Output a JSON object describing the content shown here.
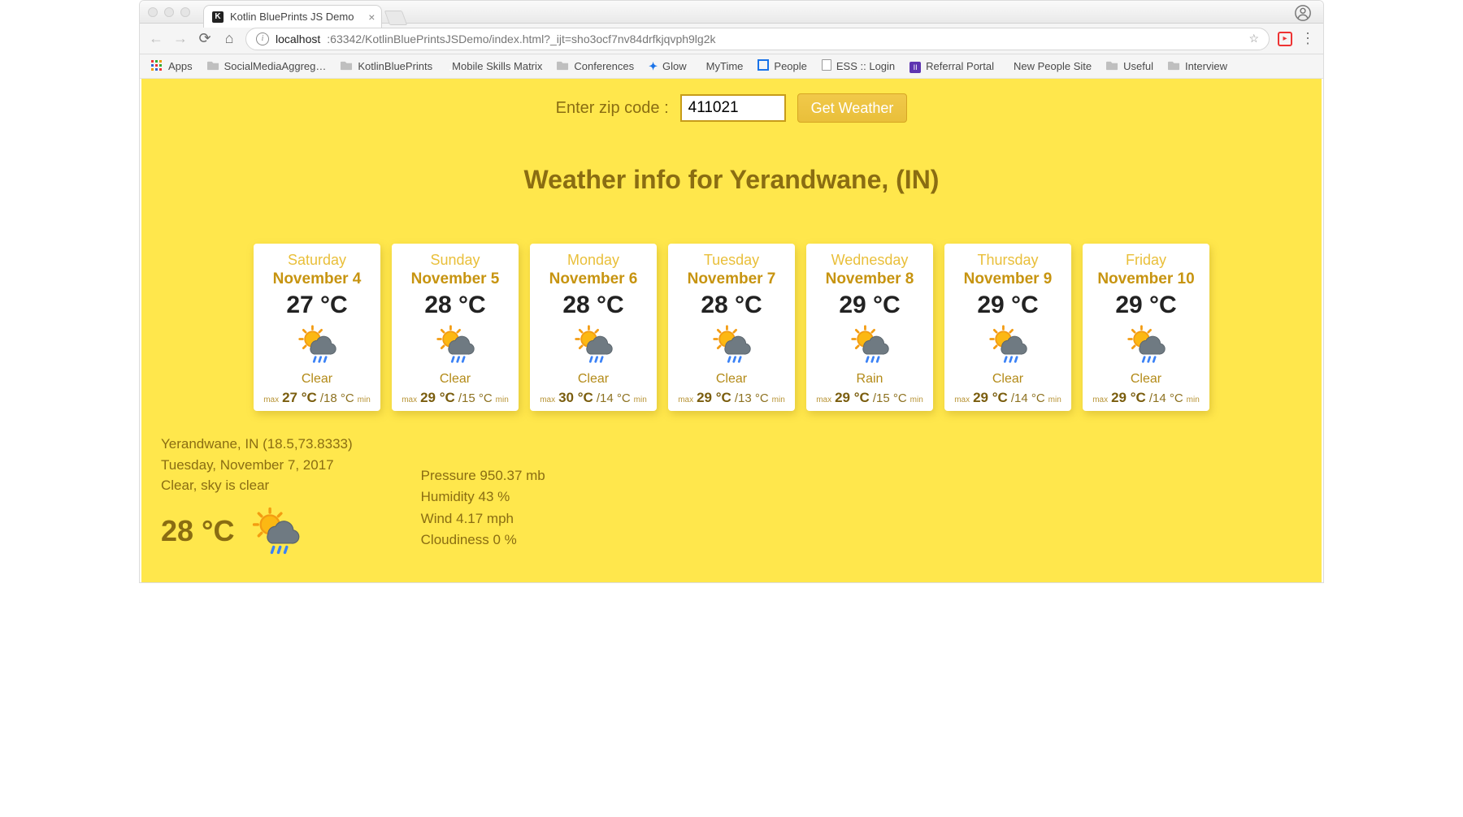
{
  "browser": {
    "tab_title": "Kotlin BluePrints JS Demo",
    "url_host": "localhost",
    "url_path": ":63342/KotlinBluePrintsJSDemo/index.html?_ijt=sho3ocf7nv84drfkjqvph9lg2k",
    "bookmarks": [
      {
        "kind": "apps",
        "label": "Apps"
      },
      {
        "kind": "folder",
        "label": "SocialMediaAggreg…"
      },
      {
        "kind": "folder",
        "label": "KotlinBluePrints"
      },
      {
        "kind": "sheet",
        "label": "Mobile Skills Matrix"
      },
      {
        "kind": "folder",
        "label": "Conferences"
      },
      {
        "kind": "glow",
        "label": "Glow"
      },
      {
        "kind": "mytime",
        "label": "MyTime"
      },
      {
        "kind": "people",
        "label": "People"
      },
      {
        "kind": "doc",
        "label": "ESS :: Login"
      },
      {
        "kind": "rp",
        "label": "Referral Portal"
      },
      {
        "kind": "np",
        "label": "New People Site"
      },
      {
        "kind": "folder",
        "label": "Useful"
      },
      {
        "kind": "folder",
        "label": "Interview"
      }
    ]
  },
  "app": {
    "zip_label": "Enter zip code :",
    "zip_value": "411021",
    "button_label": "Get Weather",
    "heading": "Weather info for Yerandwane, (IN)",
    "forecast": [
      {
        "day": "Saturday",
        "date": "November 4",
        "temp": "27 °C",
        "cond": "Clear",
        "max": "27 °C",
        "min": "/18 °C"
      },
      {
        "day": "Sunday",
        "date": "November 5",
        "temp": "28 °C",
        "cond": "Clear",
        "max": "29 °C",
        "min": "/15 °C"
      },
      {
        "day": "Monday",
        "date": "November 6",
        "temp": "28 °C",
        "cond": "Clear",
        "max": "30 °C",
        "min": "/14 °C"
      },
      {
        "day": "Tuesday",
        "date": "November 7",
        "temp": "28 °C",
        "cond": "Clear",
        "max": "29 °C",
        "min": "/13 °C"
      },
      {
        "day": "Wednesday",
        "date": "November 8",
        "temp": "29 °C",
        "cond": "Rain",
        "max": "29 °C",
        "min": "/15 °C"
      },
      {
        "day": "Thursday",
        "date": "November 9",
        "temp": "29 °C",
        "cond": "Clear",
        "max": "29 °C",
        "min": "/14 °C"
      },
      {
        "day": "Friday",
        "date": "November 10",
        "temp": "29 °C",
        "cond": "Clear",
        "max": "29 °C",
        "min": "/14 °C"
      }
    ],
    "labels": {
      "max": "max",
      "min": "min"
    },
    "details": {
      "location_line": "Yerandwane, IN (18.5,73.8333)",
      "today_line": "Tuesday, November 7, 2017",
      "cond_line": "Clear, sky is clear",
      "now_temp": "28 °C",
      "pressure": "Pressure 950.37 mb",
      "humidity": "Humidity 43 %",
      "wind": "Wind 4.17 mph",
      "cloud": "Cloudiness 0 %"
    }
  }
}
